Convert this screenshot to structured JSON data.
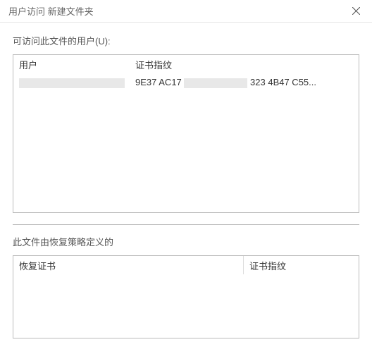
{
  "window": {
    "title": "用户访问 新建文件夹",
    "close_label": "Close"
  },
  "sections": {
    "users_label": "可访问此文件的用户(U):",
    "recovery_label": "此文件由恢复策略定义的"
  },
  "users_table": {
    "headers": {
      "user": "用户",
      "fingerprint": "证书指纹"
    },
    "rows": [
      {
        "user": "",
        "fingerprint_pre": "9E37 AC17",
        "fingerprint_post": "323 4B47 C55..."
      }
    ]
  },
  "recovery_table": {
    "headers": {
      "cert": "恢复证书",
      "fingerprint": "证书指纹"
    }
  }
}
